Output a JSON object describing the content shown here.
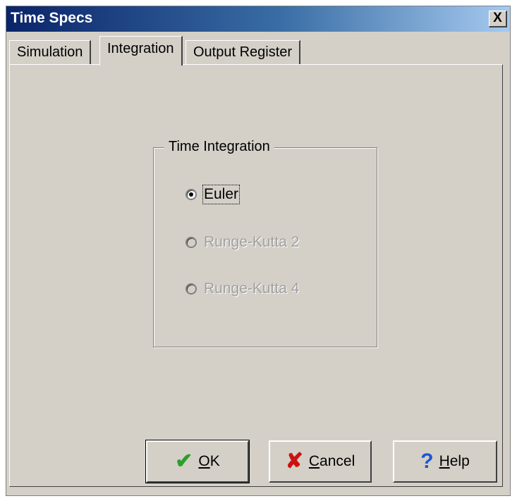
{
  "window": {
    "title": "Time Specs",
    "close_symbol": "X"
  },
  "tabs": [
    {
      "label": "Simulation",
      "active": false
    },
    {
      "label": "Integration",
      "active": true
    },
    {
      "label": "Output Register",
      "active": false
    }
  ],
  "time_integration": {
    "legend": "Time Integration",
    "options": [
      {
        "label": "Euler",
        "checked": true,
        "enabled": true
      },
      {
        "label": "Runge-Kutta 2",
        "checked": false,
        "enabled": false
      },
      {
        "label": "Runge-Kutta 4",
        "checked": false,
        "enabled": false
      }
    ]
  },
  "buttons": {
    "ok": {
      "hotkey": "O",
      "rest": "K",
      "icon": "checkmark-icon",
      "color": "#2aa02a"
    },
    "cancel": {
      "hotkey": "C",
      "rest": "ancel",
      "icon": "x-mark-icon",
      "color": "#cc1111"
    },
    "help": {
      "hotkey": "H",
      "rest": "elp",
      "icon": "question-mark-icon",
      "color": "#1a56d6"
    }
  },
  "colors": {
    "titlebar_start": "#0a246a",
    "titlebar_end": "#a6caf0",
    "face": "#d4d0c8"
  }
}
